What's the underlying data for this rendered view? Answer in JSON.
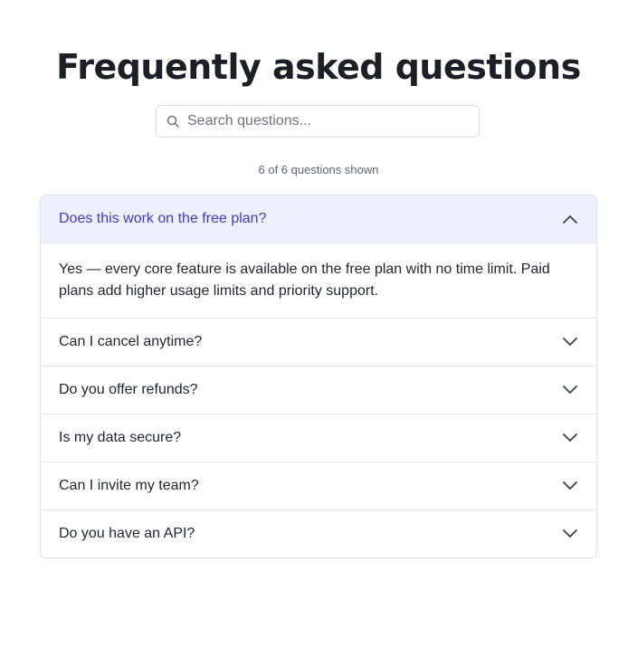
{
  "heading": "Frequently asked questions",
  "search": {
    "placeholder": "Search questions...",
    "value": ""
  },
  "count_text": "6 of 6 questions shown",
  "faqs": [
    {
      "question": "Does this work on the free plan?",
      "answer": "Yes — every core feature is available on the free plan with no time limit. Paid plans add higher usage limits and priority support.",
      "expanded": true
    },
    {
      "question": "Can I cancel anytime?",
      "expanded": false
    },
    {
      "question": "Do you offer refunds?",
      "expanded": false
    },
    {
      "question": "Is my data secure?",
      "expanded": false
    },
    {
      "question": "Can I invite my team?",
      "expanded": false
    },
    {
      "question": "Do you have an API?",
      "expanded": false
    }
  ],
  "colors": {
    "accent": "#4338ca",
    "open_background": "#eef0fd",
    "border": "#dfe2e8"
  },
  "icons": {
    "search": "search-icon",
    "expanded": "chevron-up-icon",
    "collapsed": "chevron-down-icon"
  }
}
